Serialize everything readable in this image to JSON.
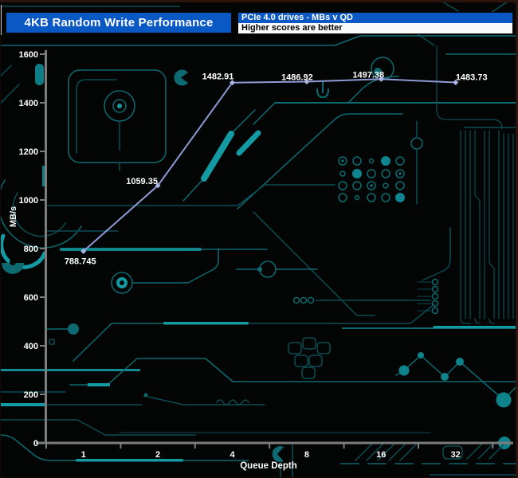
{
  "header": {
    "title": "4KB Random Write Performance",
    "subtitle_top": "PCIe 4.0 drives - MBs v QD",
    "subtitle_bottom": "Higher scores are better"
  },
  "chart_data": {
    "type": "line",
    "title": "4KB Random Write Performance",
    "categories": [
      "1",
      "2",
      "4",
      "8",
      "16",
      "32"
    ],
    "series": [
      {
        "name": "PCIe 4.0 drive",
        "values": [
          788.745,
          1059.35,
          1482.91,
          1486.92,
          1497.38,
          1483.73
        ]
      }
    ],
    "point_labels": [
      "788.745",
      "1059.35",
      "1482.91",
      "1486.92",
      "1497.38",
      "1483.73"
    ],
    "xlabel": "Queue Depth",
    "ylabel": "MB/s",
    "ylim": [
      0,
      1600
    ],
    "ytick_step": 200,
    "grid": false,
    "legend_position": "none",
    "colors": {
      "line": "#8d9cd4",
      "marker": "#aab6e6",
      "axis": "#7d7d7d",
      "labels": "#ffffff",
      "background": "#030404",
      "circuit_trace": "#0d6a70",
      "circuit_bright": "#149aa2",
      "header_blue": "#0a58c4"
    }
  }
}
